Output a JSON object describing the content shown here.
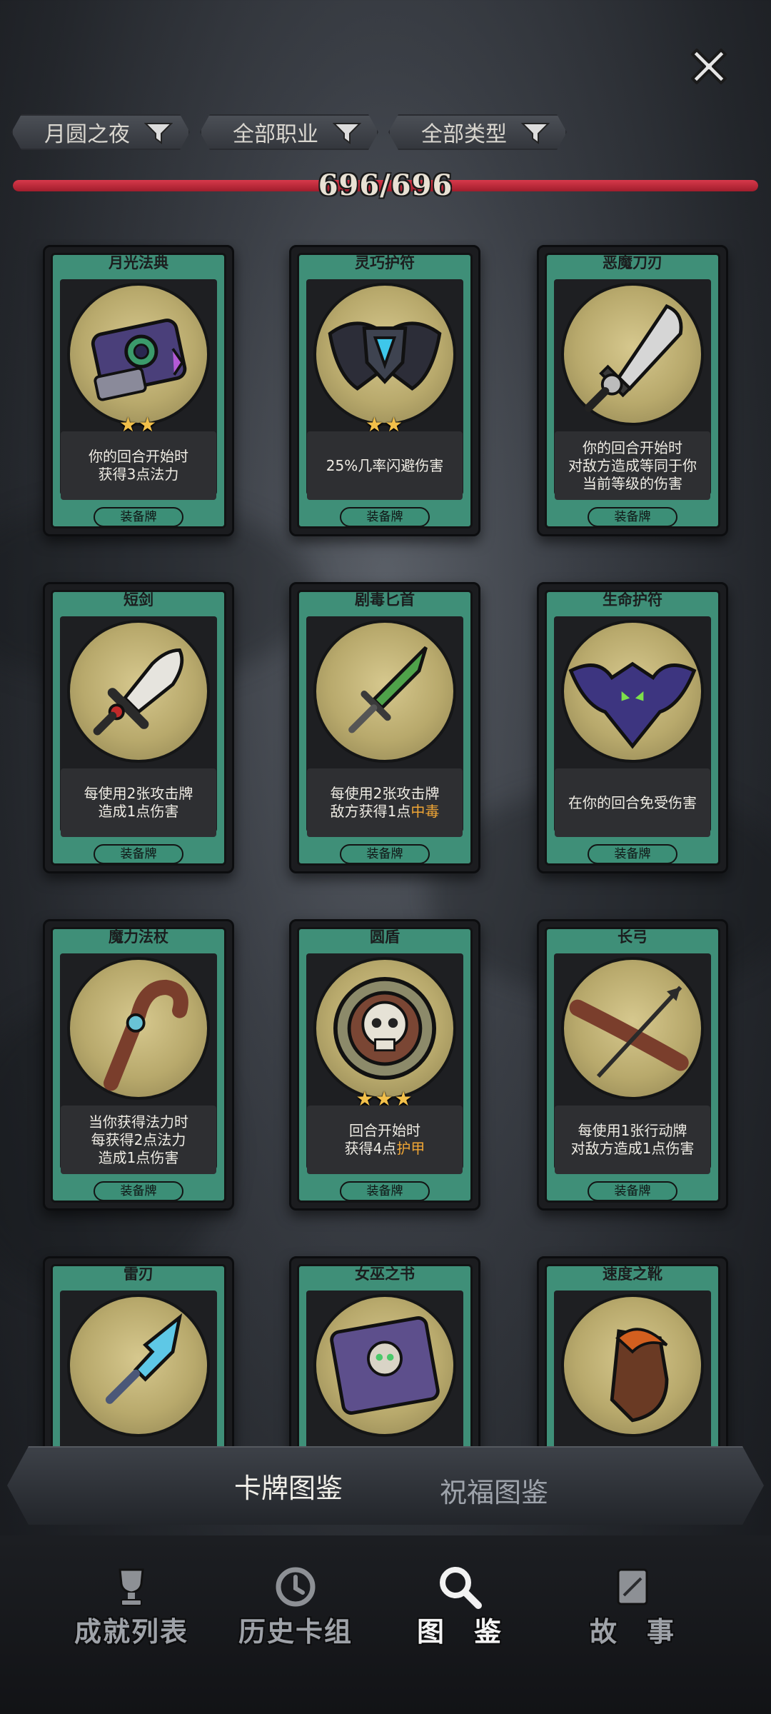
{
  "close_icon": "close-x-icon",
  "filters": [
    {
      "label": "月圆之夜",
      "icon": "filter-funnel-icon"
    },
    {
      "label": "全部职业",
      "icon": "filter-funnel-icon"
    },
    {
      "label": "全部类型",
      "icon": "filter-funnel-icon"
    }
  ],
  "progress": {
    "text": "696/696",
    "fraction": 1.0,
    "color": "#c82a3b"
  },
  "cards": [
    {
      "title": "月光法典",
      "stars": "★★",
      "desc": [
        "你的回合开始时",
        "获得3点法力"
      ],
      "type": "装备牌",
      "art": "tome-icon"
    },
    {
      "title": "灵巧护符",
      "stars": "★★",
      "desc": [
        "25%几率闪避伤害"
      ],
      "type": "装备牌",
      "art": "winged-shield-icon"
    },
    {
      "title": "恶魔刀刃",
      "stars": "",
      "desc": [
        "你的回合开始时",
        "对敌方造成等同于你",
        "当前等级的伤害"
      ],
      "type": "装备牌",
      "art": "demon-blade-icon"
    },
    {
      "title": "短剑",
      "stars": "",
      "desc": [
        "每使用2张攻击牌",
        "造成1点伤害"
      ],
      "type": "装备牌",
      "art": "short-sword-icon"
    },
    {
      "title": "剧毒匕首",
      "stars": "",
      "desc": [
        "每使用2张攻击牌",
        "敌方获得1点",
        "中毒"
      ],
      "type": "装备牌",
      "art": "poison-dagger-icon"
    },
    {
      "title": "生命护符",
      "stars": "",
      "desc": [
        "在你的回合免受伤害"
      ],
      "type": "装备牌",
      "art": "bat-amulet-icon"
    },
    {
      "title": "魔力法杖",
      "stars": "",
      "desc": [
        "当你获得法力时",
        "每获得2点法力",
        "造成1点伤害"
      ],
      "type": "装备牌",
      "art": "magic-staff-icon"
    },
    {
      "title": "圆盾",
      "stars": "★★★",
      "desc": [
        "回合开始时",
        "获得4点",
        "护甲"
      ],
      "type": "装备牌",
      "art": "skull-shield-icon"
    },
    {
      "title": "长弓",
      "stars": "",
      "desc": [
        "每使用1张行动牌",
        "对敌方造成1点伤害"
      ],
      "type": "装备牌",
      "art": "longbow-icon"
    },
    {
      "title": "雷刃",
      "stars": "",
      "desc": [],
      "type": "",
      "art": "thunder-blade-icon"
    },
    {
      "title": "女巫之书",
      "stars": "",
      "desc": [],
      "type": "",
      "art": "witch-book-icon"
    },
    {
      "title": "速度之靴",
      "stars": "",
      "desc": [],
      "type": "",
      "art": "speed-boots-icon"
    }
  ],
  "subtabs": [
    {
      "label": "卡牌图鉴",
      "active": true
    },
    {
      "label": "祝福图鉴",
      "active": false
    }
  ],
  "nav": [
    {
      "label": "成就列表",
      "icon": "trophy-icon"
    },
    {
      "label": "历史卡组",
      "icon": "history-clock-icon"
    },
    {
      "label": "图　鉴",
      "icon": "magnifier-icon"
    },
    {
      "label": "故　事",
      "icon": "story-book-icon"
    }
  ]
}
